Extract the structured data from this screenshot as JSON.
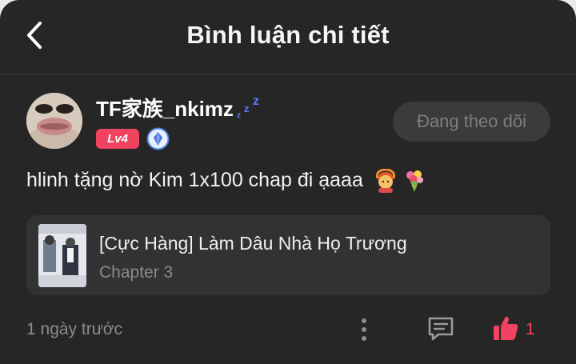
{
  "header": {
    "title": "Bình luận chi tiết",
    "back_icon": "chevron-left-icon"
  },
  "user": {
    "name": "TF家族_nkimz",
    "status_icon": "sleep-zzz-icon",
    "level": "Lv4",
    "vip_icon": "diamond-badge-icon"
  },
  "follow_button": {
    "label": "Đang theo dõi"
  },
  "comment": {
    "text": "hlinh tặng nờ Kim 1x100 chap đi ạaaa",
    "emojis": [
      "person-gesturing-ok-emoji",
      "bouquet-emoji"
    ]
  },
  "story": {
    "title": "[Cực Hàng] Làm Dâu Nhà Họ Trương",
    "chapter": "Chapter 3"
  },
  "footer": {
    "time": "1 ngày trước",
    "like_count": "1",
    "more_icon": "more-vertical-icon",
    "reply_icon": "comment-icon",
    "like_icon": "thumbs-up-icon"
  },
  "colors": {
    "background": "#262626",
    "accent": "#f0435f",
    "card": "#323232",
    "muted_text": "#8c8c8c"
  }
}
